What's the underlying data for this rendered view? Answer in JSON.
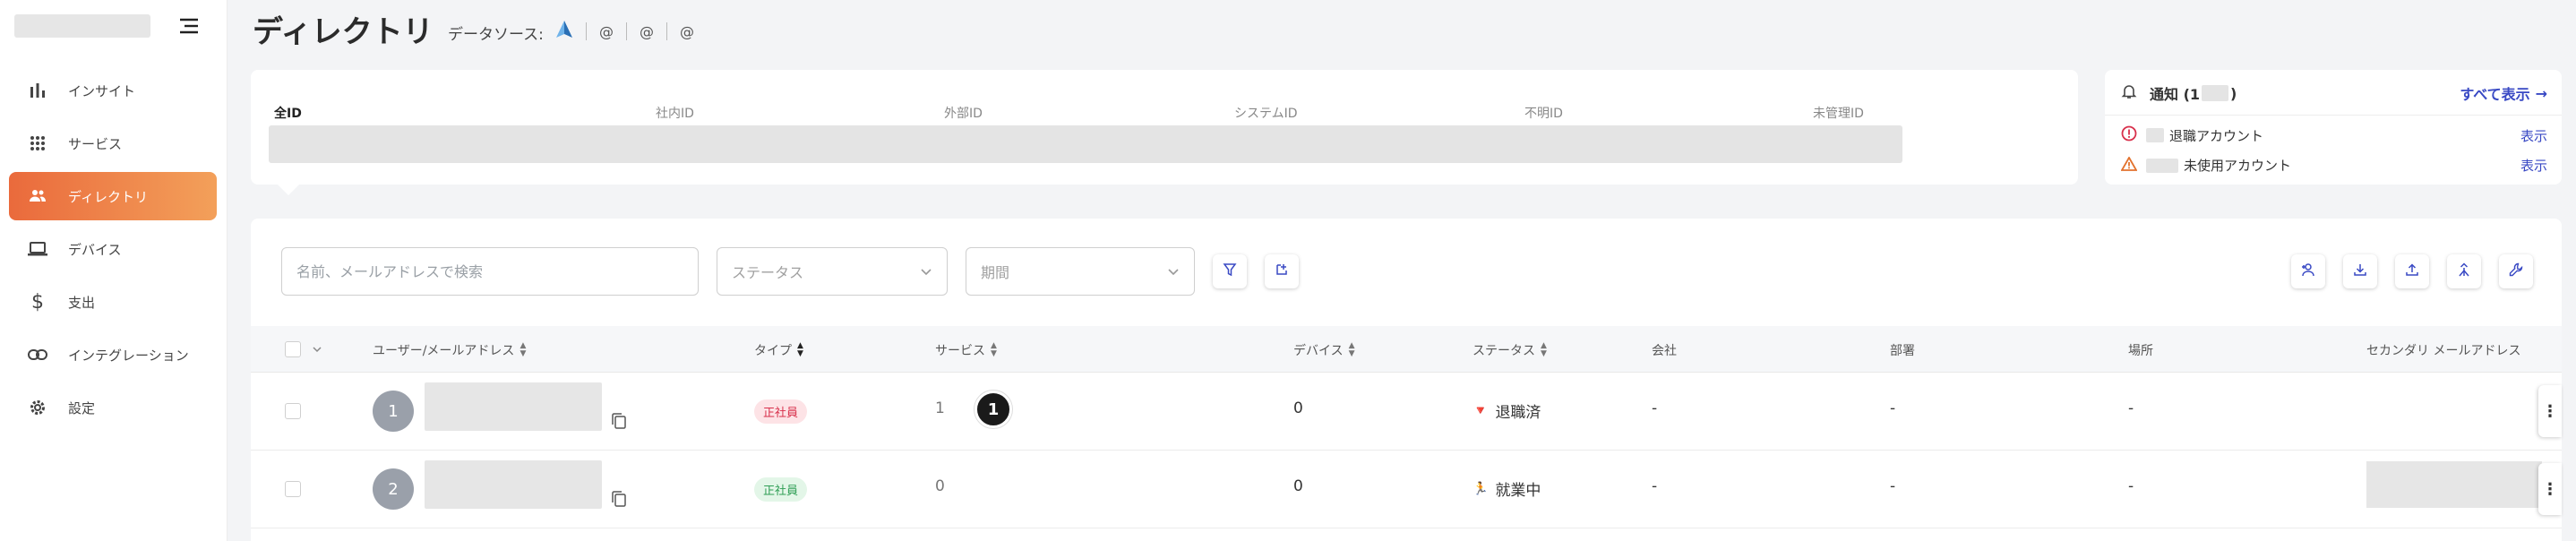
{
  "sidebar": {
    "items": [
      {
        "label": "インサイト",
        "icon": "bar-chart-icon"
      },
      {
        "label": "サービス",
        "icon": "grid-icon"
      },
      {
        "label": "ディレクトリ",
        "icon": "users-icon",
        "active": true
      },
      {
        "label": "デバイス",
        "icon": "laptop-icon"
      },
      {
        "label": "支出",
        "icon": "dollar-icon"
      },
      {
        "label": "インテグレーション",
        "icon": "link-icon"
      },
      {
        "label": "設定",
        "icon": "gear-icon"
      }
    ]
  },
  "header": {
    "title": "ディレクトリ",
    "datasource_label": "データソース:",
    "datasource_icons": [
      "@",
      "@",
      "@"
    ]
  },
  "id_tabs": [
    "全ID",
    "社内ID",
    "外部ID",
    "システムID",
    "不明ID",
    "未管理ID"
  ],
  "notifications": {
    "title_prefix": "通知 (1",
    "title_suffix": ")",
    "show_all": "すべて表示",
    "items": [
      {
        "label": "退職アカウント",
        "link": "表示",
        "icon": "alert-circle-icon"
      },
      {
        "label": "未使用アカウント",
        "link": "表示",
        "icon": "warning-triangle-icon"
      }
    ]
  },
  "filters": {
    "search_placeholder": "名前、メールアドレスで検索",
    "status_placeholder": "ステータス",
    "period_placeholder": "期間"
  },
  "table": {
    "columns": [
      "ユーザー/メールアドレス",
      "タイプ",
      "サービス",
      "デバイス",
      "ステータス",
      "会社",
      "部署",
      "場所",
      "セカンダリ メールアドレス"
    ],
    "rows": [
      {
        "avatar": "1",
        "type": "正社員",
        "type_color": "red",
        "services": "1",
        "service_logo": "1",
        "devices": "0",
        "status_icon": "🔻",
        "status": "退職済",
        "company": "-",
        "department": "-",
        "location": "-"
      },
      {
        "avatar": "2",
        "type": "正社員",
        "type_color": "green",
        "services": "0",
        "devices": "0",
        "status_icon": "🏃",
        "status": "就業中",
        "company": "-",
        "department": "-",
        "location": "-"
      }
    ]
  },
  "colors": {
    "accent_start": "#ea6a3c",
    "accent_end": "#f3a05a",
    "link": "#3949c4"
  }
}
